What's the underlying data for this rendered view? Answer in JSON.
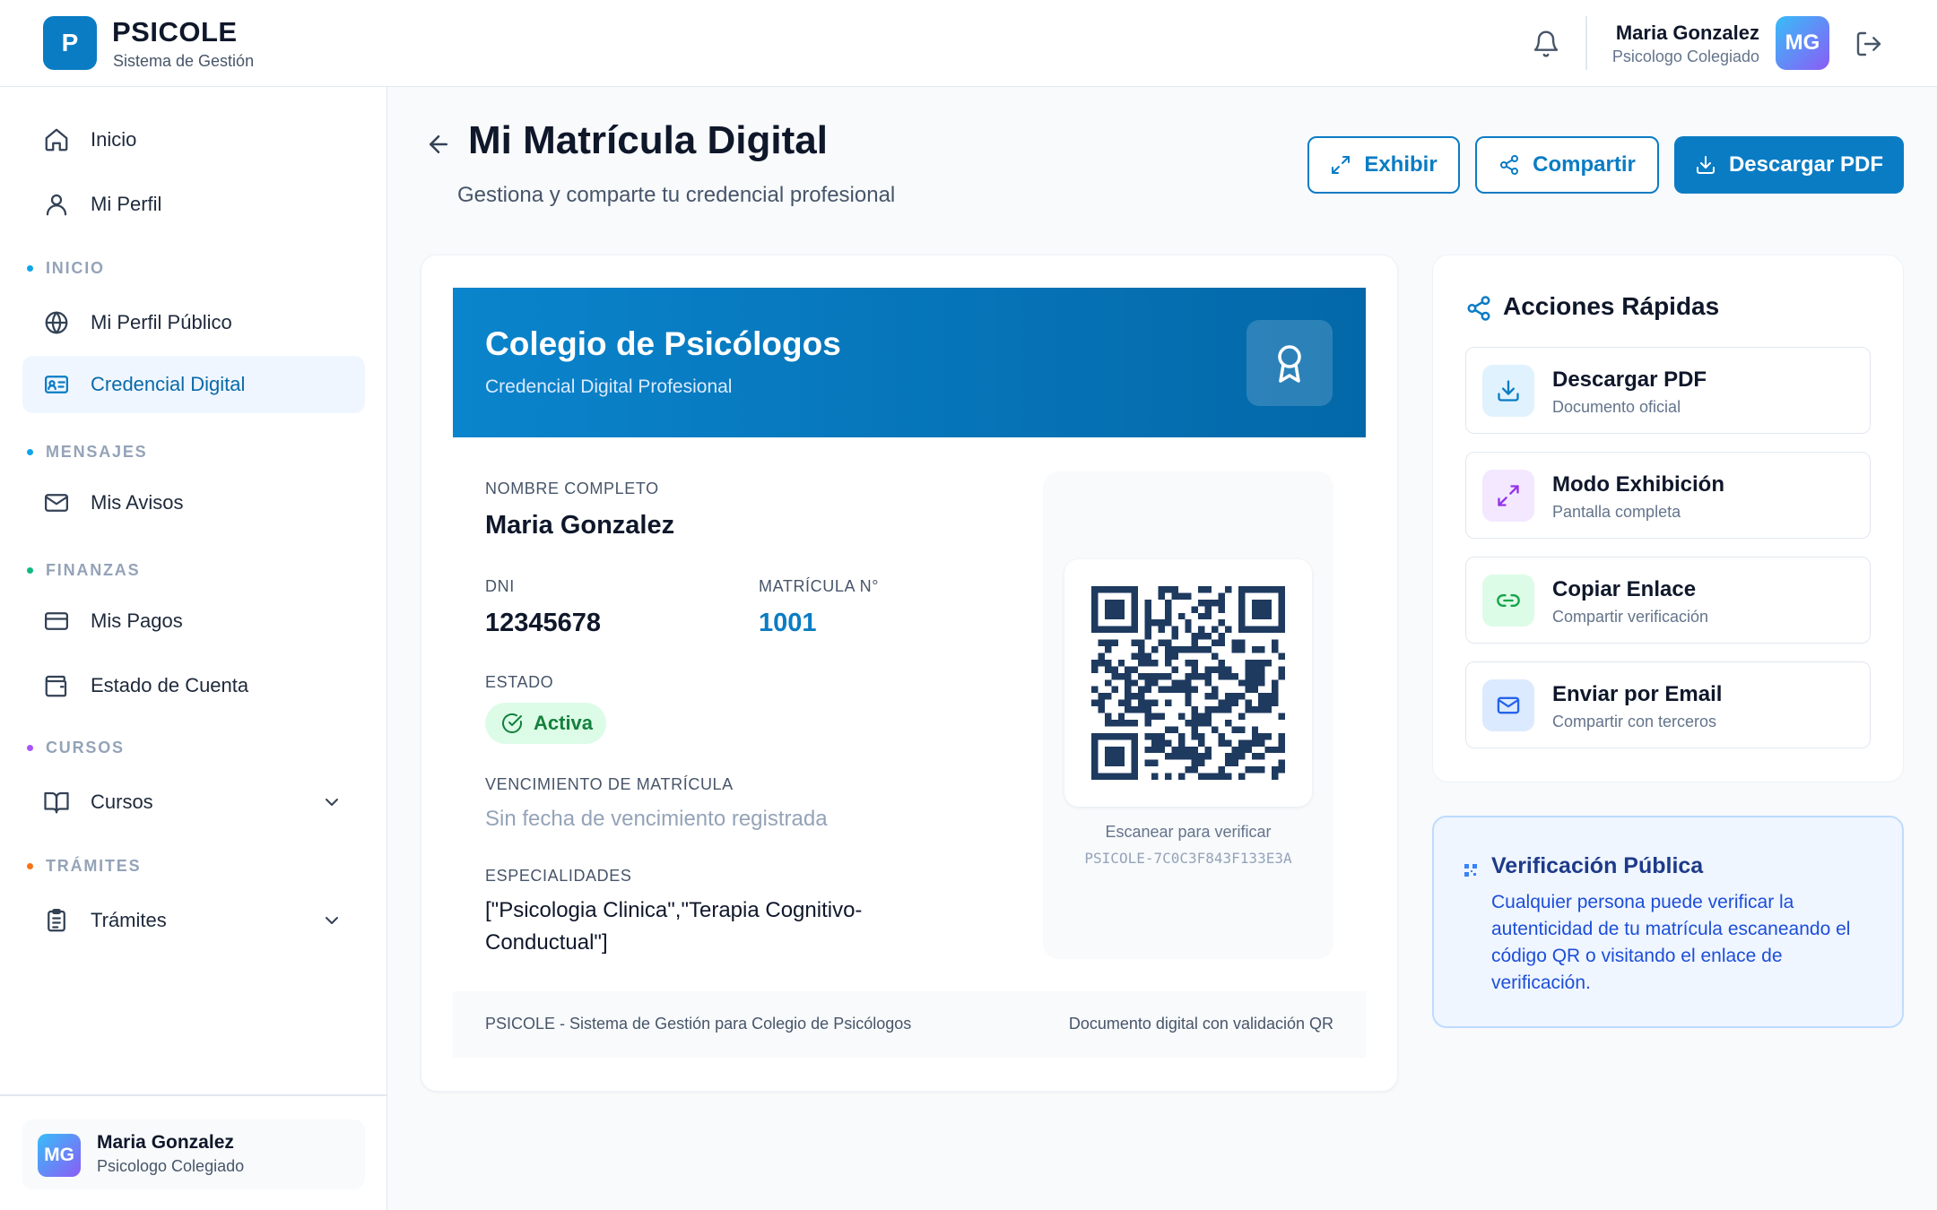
{
  "app": {
    "logo_letter": "P",
    "name": "PSICOLE",
    "subtitle": "Sistema de Gestión"
  },
  "user": {
    "name": "Maria Gonzalez",
    "role": "Psicologo Colegiado",
    "initials": "MG"
  },
  "sidebar": {
    "items": [
      {
        "label": "Inicio",
        "icon": "home-icon"
      },
      {
        "label": "Mi Perfil",
        "icon": "user-icon"
      },
      {
        "label": "Mi Perfil Público",
        "icon": "globe-icon"
      },
      {
        "label": "Credencial Digital",
        "icon": "id-card-icon",
        "active": true
      },
      {
        "label": "Mis Avisos",
        "icon": "mail-icon"
      },
      {
        "label": "Mis Pagos",
        "icon": "credit-card-icon"
      },
      {
        "label": "Estado de Cuenta",
        "icon": "wallet-icon"
      },
      {
        "label": "Cursos",
        "icon": "book-icon",
        "expandable": true
      },
      {
        "label": "Trámites",
        "icon": "clipboard-icon",
        "expandable": true
      }
    ],
    "sections": [
      {
        "label": "INICIO",
        "color": "#0ea5e9"
      },
      {
        "label": "MENSAJES",
        "color": "#0ea5e9"
      },
      {
        "label": "FINANZAS",
        "color": "#10b981"
      },
      {
        "label": "CURSOS",
        "color": "#a855f7"
      },
      {
        "label": "TRÁMITES",
        "color": "#f97316"
      }
    ]
  },
  "page": {
    "title": "Mi Matrícula Digital",
    "subtitle": "Gestiona y comparte tu credencial profesional",
    "buttons": {
      "exhibit": "Exhibir",
      "share": "Compartir",
      "download": "Descargar PDF"
    }
  },
  "credential": {
    "org": "Colegio de Psicólogos",
    "type": "Credencial Digital Profesional",
    "name_label": "NOMBRE COMPLETO",
    "name": "Maria Gonzalez",
    "dni_label": "DNI",
    "dni": "12345678",
    "matricula_label": "MATRÍCULA N°",
    "matricula": "1001",
    "status_label": "ESTADO",
    "status": "Activa",
    "expiry_label": "VENCIMIENTO DE MATRÍCULA",
    "expiry": "Sin fecha de vencimiento registrada",
    "specialties_label": "ESPECIALIDADES",
    "specialties": "[\"Psicologia Clinica\",\"Terapia Cognitivo-Conductual\"]",
    "qr_caption": "Escanear para verificar",
    "qr_id": "PSICOLE-7C0C3F843F133E3A",
    "footer_left": "PSICOLE - Sistema de Gestión para Colegio de Psicólogos",
    "footer_right": "Documento digital con validación QR"
  },
  "quick_actions": {
    "title": "Acciones Rápidas",
    "items": [
      {
        "label": "Descargar PDF",
        "sub": "Documento oficial",
        "icon": "download-icon",
        "color": "#0a7cc4",
        "bg": "#e0f2fe"
      },
      {
        "label": "Modo Exhibición",
        "sub": "Pantalla completa",
        "icon": "expand-icon",
        "color": "#9333ea",
        "bg": "#f3e8ff"
      },
      {
        "label": "Copiar Enlace",
        "sub": "Compartir verificación",
        "icon": "link-icon",
        "color": "#16a34a",
        "bg": "#dcfce7"
      },
      {
        "label": "Enviar por Email",
        "sub": "Compartir con terceros",
        "icon": "mail-icon",
        "color": "#2563eb",
        "bg": "#dbeafe"
      }
    ]
  },
  "verification": {
    "title": "Verificación Pública",
    "text": "Cualquier persona puede verificar la autenticidad de tu matrícula escaneando el código QR o visitando el enlace de verificación."
  },
  "colors": {
    "primary": "#0a7cc4",
    "active_bg": "#eff6ff",
    "success": "#15803d",
    "success_bg": "#dcfce7"
  }
}
